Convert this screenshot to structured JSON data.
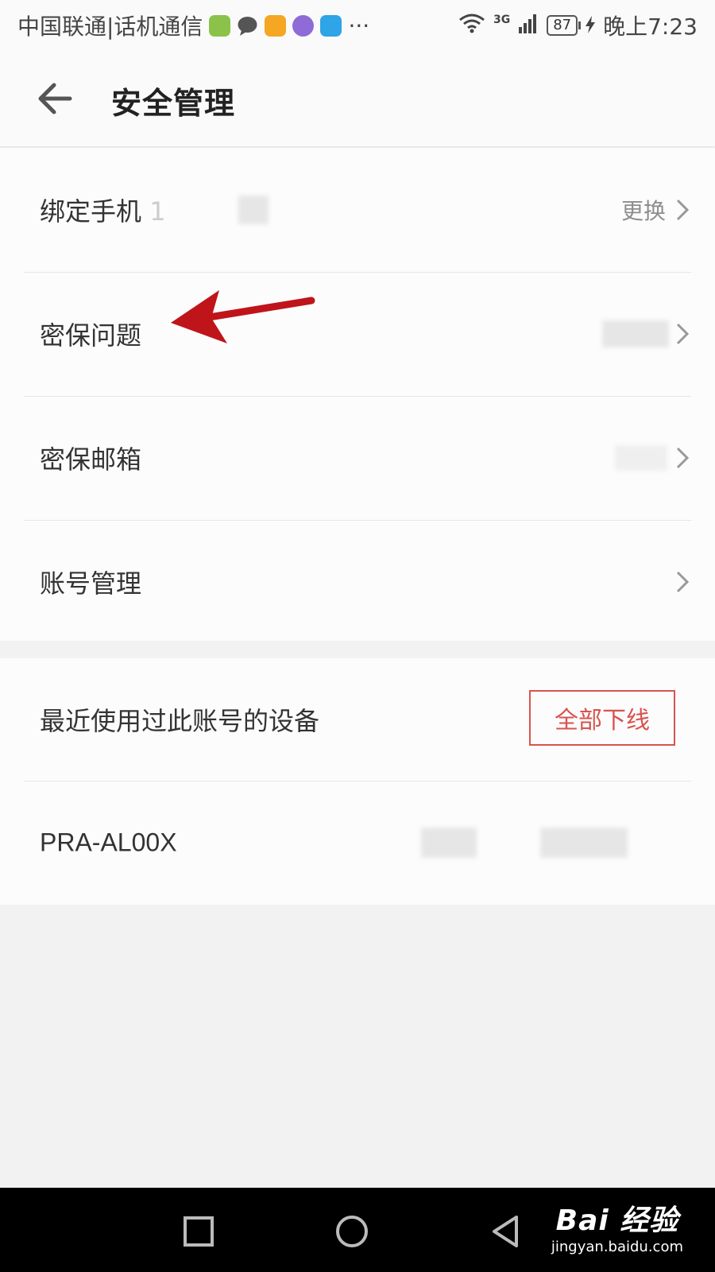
{
  "status_bar": {
    "carrier": "中国联通|话机通信",
    "more": "···",
    "network": "3G",
    "battery": "87",
    "time": "晚上7:23"
  },
  "header": {
    "title": "安全管理"
  },
  "security": {
    "items": [
      {
        "label": "绑定手机",
        "partial_number": "1",
        "action": "更换"
      },
      {
        "label": "密保问题"
      },
      {
        "label": "密保邮箱"
      },
      {
        "label": "账号管理"
      }
    ]
  },
  "devices": {
    "title": "最近使用过此账号的设备",
    "logout_all": "全部下线",
    "list": [
      {
        "name": "PRA-AL00X"
      }
    ]
  },
  "watermark": {
    "brand": "Bai  经验",
    "url": "jingyan.baidu.com"
  },
  "colors": {
    "accent_red": "#d9534f",
    "annotation_arrow": "#c0141b"
  }
}
